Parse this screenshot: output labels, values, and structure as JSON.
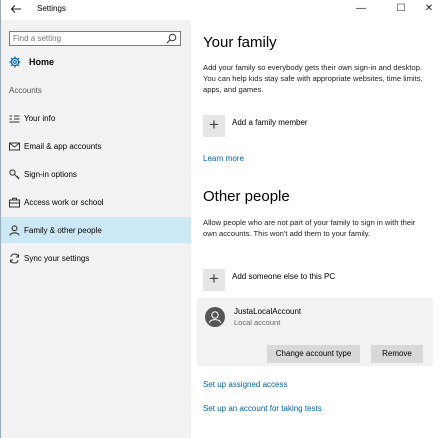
{
  "window": {
    "title": "Settings",
    "minimize": "—",
    "maximize": "☐",
    "close": "✕"
  },
  "sidebar": {
    "search_placeholder": "Find a setting",
    "home_label": "Home",
    "section_label": "Accounts",
    "items": [
      {
        "label": "Your info",
        "icon": "your-info-icon"
      },
      {
        "label": "Email & app accounts",
        "icon": "email-icon"
      },
      {
        "label": "Sign-in options",
        "icon": "key-icon"
      },
      {
        "label": "Access work or school",
        "icon": "briefcase-icon"
      },
      {
        "label": "Family & other people",
        "icon": "person-icon",
        "selected": true
      },
      {
        "label": "Sync your settings",
        "icon": "sync-icon"
      }
    ]
  },
  "main": {
    "family": {
      "title": "Your family",
      "description": "Add your family so everybody gets their own sign-in and desktop. You can help kids stay safe with appropriate websites, time limits, apps, and games.",
      "add_label": "Add a family member",
      "learn_more": "Learn more"
    },
    "other": {
      "title": "Other people",
      "description": "Allow people who are not part of your family to sign in with their own accounts. This won't add them to your family.",
      "add_label": "Add someone else to this PC",
      "account_name": "JustaLocalAccount",
      "account_type": "Local account",
      "change_button": "Change account type",
      "remove_button": "Remove"
    },
    "links": {
      "assigned_access": "Set up assigned access",
      "tests": "Set up an account for taking tests"
    }
  },
  "colors": {
    "accent": "#0063b1",
    "selected_bg": "#cce8f4",
    "sidebar_bg": "#f2f2f2"
  }
}
